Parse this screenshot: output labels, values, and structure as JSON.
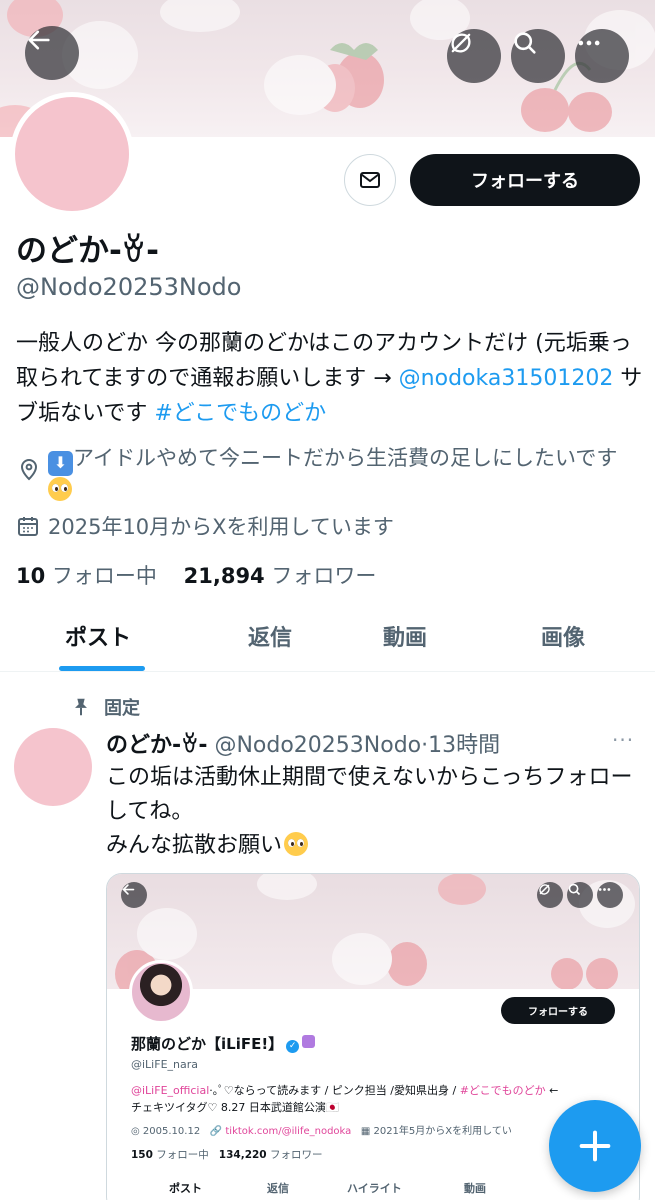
{
  "header": {
    "back_icon": "arrow-left-icon",
    "actions": [
      "sync-off-icon",
      "search-icon",
      "more-icon"
    ]
  },
  "profile": {
    "display_name": "のどか-ꈊ-",
    "handle": "@Nodo20253Nodo",
    "follow_label": "フォローする",
    "bio_text": "一般人のどか 今の那蘭のどかはこのアカウントだけ (元垢乗っ取られてますので通報お願いします → ",
    "bio_mention": "@nodoka31501202",
    "bio_mid": " サブ垢ないです ",
    "bio_hashtag": "#どこでものどか",
    "location": "アイドルやめて今ニートだから生活費の足しにしたいです",
    "joined": "2025年10月からXを利用しています",
    "following_count": "10",
    "following_label": "フォロー中",
    "followers_count": "21,894",
    "followers_label": "フォロワー"
  },
  "tabs": [
    "ポスト",
    "返信",
    "動画",
    "画像"
  ],
  "pinned_post": {
    "pinned_label": "固定",
    "author_name": "のどか-ꈊ-",
    "author_handle": "@Nodo20253Nodo",
    "time": "·13時間",
    "more": "···",
    "line1": "この垢は活動休止期間で使えないからこっちフォローしてね。",
    "line2": "みんな拡散お願い",
    "embed": {
      "follow_label": "フォローする",
      "name": "那蘭のどか【iLiFE!】",
      "handle": "@iLiFE_nara",
      "bio_mention": "@iLiFE_official",
      "bio_text": "·｡ﾟ♡ならって読みます / ピンク担当 /愛知県出身 / ",
      "bio_hashtag": "#どこでものどか",
      "bio_line2": "チェキツイタグ♡ 8.27 日本武道館公演🇯🇵",
      "birth": "2005.10.12",
      "link": "tiktok.com/@ilife_nodoka",
      "joined": "2021年5月からXを利用してい",
      "following_count": "150",
      "following_label": "フォロー中",
      "followers_count": "134,220",
      "followers_label": "フォロワー",
      "tabs": [
        "ポスト",
        "返信",
        "ハイライト",
        "動画"
      ]
    }
  },
  "fab_icon": "plus-icon",
  "colors": {
    "accent": "#1d9bf0",
    "avatar_pink": "#f5c4cd",
    "text_secondary": "#536471",
    "embed_pink": "#e0459a"
  }
}
